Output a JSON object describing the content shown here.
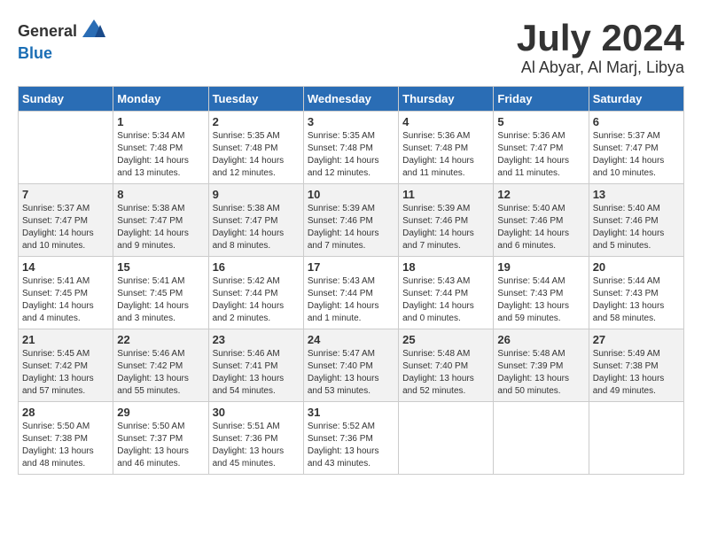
{
  "header": {
    "logo_general": "General",
    "logo_blue": "Blue",
    "month": "July 2024",
    "location": "Al Abyar, Al Marj, Libya"
  },
  "calendar": {
    "days_of_week": [
      "Sunday",
      "Monday",
      "Tuesday",
      "Wednesday",
      "Thursday",
      "Friday",
      "Saturday"
    ],
    "weeks": [
      [
        {
          "day": "",
          "sunrise": "",
          "sunset": "",
          "daylight": ""
        },
        {
          "day": "1",
          "sunrise": "Sunrise: 5:34 AM",
          "sunset": "Sunset: 7:48 PM",
          "daylight": "Daylight: 14 hours and 13 minutes."
        },
        {
          "day": "2",
          "sunrise": "Sunrise: 5:35 AM",
          "sunset": "Sunset: 7:48 PM",
          "daylight": "Daylight: 14 hours and 12 minutes."
        },
        {
          "day": "3",
          "sunrise": "Sunrise: 5:35 AM",
          "sunset": "Sunset: 7:48 PM",
          "daylight": "Daylight: 14 hours and 12 minutes."
        },
        {
          "day": "4",
          "sunrise": "Sunrise: 5:36 AM",
          "sunset": "Sunset: 7:48 PM",
          "daylight": "Daylight: 14 hours and 11 minutes."
        },
        {
          "day": "5",
          "sunrise": "Sunrise: 5:36 AM",
          "sunset": "Sunset: 7:47 PM",
          "daylight": "Daylight: 14 hours and 11 minutes."
        },
        {
          "day": "6",
          "sunrise": "Sunrise: 5:37 AM",
          "sunset": "Sunset: 7:47 PM",
          "daylight": "Daylight: 14 hours and 10 minutes."
        }
      ],
      [
        {
          "day": "7",
          "sunrise": "Sunrise: 5:37 AM",
          "sunset": "Sunset: 7:47 PM",
          "daylight": "Daylight: 14 hours and 10 minutes."
        },
        {
          "day": "8",
          "sunrise": "Sunrise: 5:38 AM",
          "sunset": "Sunset: 7:47 PM",
          "daylight": "Daylight: 14 hours and 9 minutes."
        },
        {
          "day": "9",
          "sunrise": "Sunrise: 5:38 AM",
          "sunset": "Sunset: 7:47 PM",
          "daylight": "Daylight: 14 hours and 8 minutes."
        },
        {
          "day": "10",
          "sunrise": "Sunrise: 5:39 AM",
          "sunset": "Sunset: 7:46 PM",
          "daylight": "Daylight: 14 hours and 7 minutes."
        },
        {
          "day": "11",
          "sunrise": "Sunrise: 5:39 AM",
          "sunset": "Sunset: 7:46 PM",
          "daylight": "Daylight: 14 hours and 7 minutes."
        },
        {
          "day": "12",
          "sunrise": "Sunrise: 5:40 AM",
          "sunset": "Sunset: 7:46 PM",
          "daylight": "Daylight: 14 hours and 6 minutes."
        },
        {
          "day": "13",
          "sunrise": "Sunrise: 5:40 AM",
          "sunset": "Sunset: 7:46 PM",
          "daylight": "Daylight: 14 hours and 5 minutes."
        }
      ],
      [
        {
          "day": "14",
          "sunrise": "Sunrise: 5:41 AM",
          "sunset": "Sunset: 7:45 PM",
          "daylight": "Daylight: 14 hours and 4 minutes."
        },
        {
          "day": "15",
          "sunrise": "Sunrise: 5:41 AM",
          "sunset": "Sunset: 7:45 PM",
          "daylight": "Daylight: 14 hours and 3 minutes."
        },
        {
          "day": "16",
          "sunrise": "Sunrise: 5:42 AM",
          "sunset": "Sunset: 7:44 PM",
          "daylight": "Daylight: 14 hours and 2 minutes."
        },
        {
          "day": "17",
          "sunrise": "Sunrise: 5:43 AM",
          "sunset": "Sunset: 7:44 PM",
          "daylight": "Daylight: 14 hours and 1 minute."
        },
        {
          "day": "18",
          "sunrise": "Sunrise: 5:43 AM",
          "sunset": "Sunset: 7:44 PM",
          "daylight": "Daylight: 14 hours and 0 minutes."
        },
        {
          "day": "19",
          "sunrise": "Sunrise: 5:44 AM",
          "sunset": "Sunset: 7:43 PM",
          "daylight": "Daylight: 13 hours and 59 minutes."
        },
        {
          "day": "20",
          "sunrise": "Sunrise: 5:44 AM",
          "sunset": "Sunset: 7:43 PM",
          "daylight": "Daylight: 13 hours and 58 minutes."
        }
      ],
      [
        {
          "day": "21",
          "sunrise": "Sunrise: 5:45 AM",
          "sunset": "Sunset: 7:42 PM",
          "daylight": "Daylight: 13 hours and 57 minutes."
        },
        {
          "day": "22",
          "sunrise": "Sunrise: 5:46 AM",
          "sunset": "Sunset: 7:42 PM",
          "daylight": "Daylight: 13 hours and 55 minutes."
        },
        {
          "day": "23",
          "sunrise": "Sunrise: 5:46 AM",
          "sunset": "Sunset: 7:41 PM",
          "daylight": "Daylight: 13 hours and 54 minutes."
        },
        {
          "day": "24",
          "sunrise": "Sunrise: 5:47 AM",
          "sunset": "Sunset: 7:40 PM",
          "daylight": "Daylight: 13 hours and 53 minutes."
        },
        {
          "day": "25",
          "sunrise": "Sunrise: 5:48 AM",
          "sunset": "Sunset: 7:40 PM",
          "daylight": "Daylight: 13 hours and 52 minutes."
        },
        {
          "day": "26",
          "sunrise": "Sunrise: 5:48 AM",
          "sunset": "Sunset: 7:39 PM",
          "daylight": "Daylight: 13 hours and 50 minutes."
        },
        {
          "day": "27",
          "sunrise": "Sunrise: 5:49 AM",
          "sunset": "Sunset: 7:38 PM",
          "daylight": "Daylight: 13 hours and 49 minutes."
        }
      ],
      [
        {
          "day": "28",
          "sunrise": "Sunrise: 5:50 AM",
          "sunset": "Sunset: 7:38 PM",
          "daylight": "Daylight: 13 hours and 48 minutes."
        },
        {
          "day": "29",
          "sunrise": "Sunrise: 5:50 AM",
          "sunset": "Sunset: 7:37 PM",
          "daylight": "Daylight: 13 hours and 46 minutes."
        },
        {
          "day": "30",
          "sunrise": "Sunrise: 5:51 AM",
          "sunset": "Sunset: 7:36 PM",
          "daylight": "Daylight: 13 hours and 45 minutes."
        },
        {
          "day": "31",
          "sunrise": "Sunrise: 5:52 AM",
          "sunset": "Sunset: 7:36 PM",
          "daylight": "Daylight: 13 hours and 43 minutes."
        },
        {
          "day": "",
          "sunrise": "",
          "sunset": "",
          "daylight": ""
        },
        {
          "day": "",
          "sunrise": "",
          "sunset": "",
          "daylight": ""
        },
        {
          "day": "",
          "sunrise": "",
          "sunset": "",
          "daylight": ""
        }
      ]
    ]
  }
}
